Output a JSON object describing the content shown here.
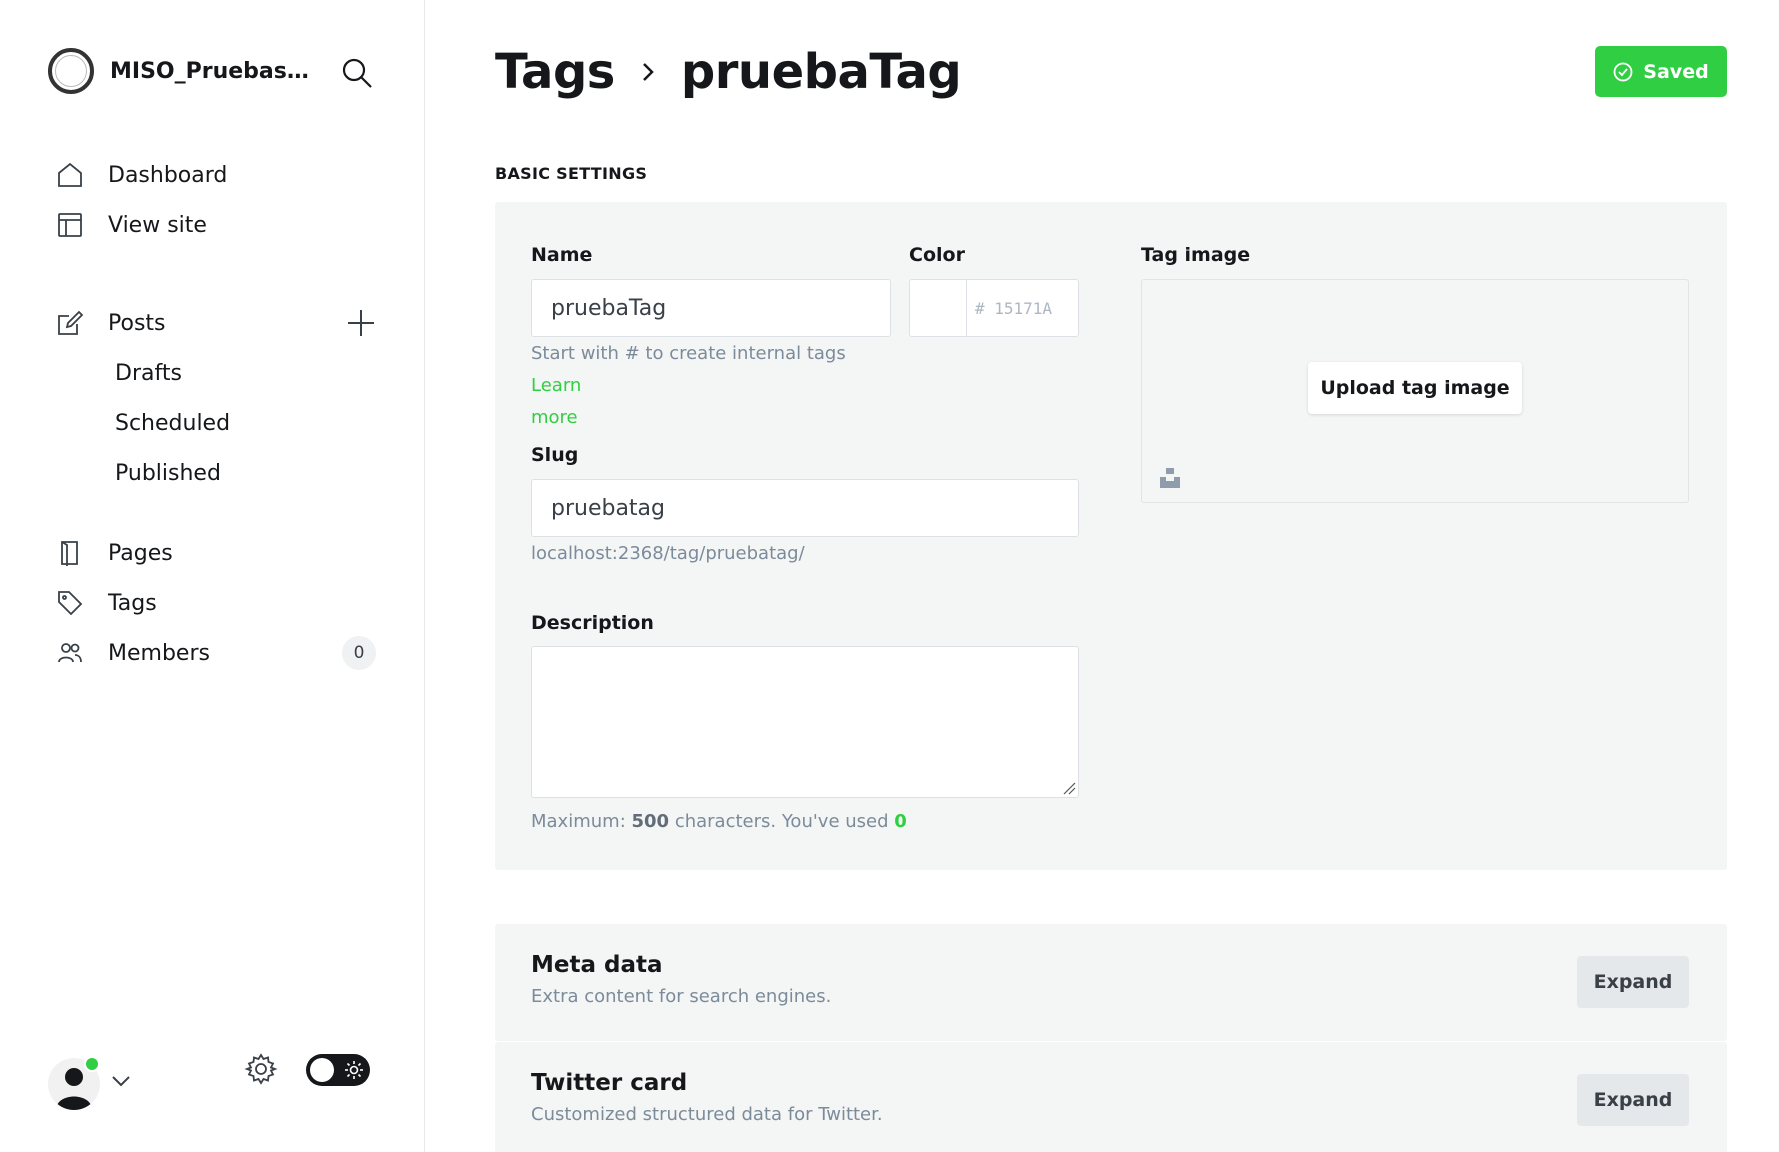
{
  "sidebar": {
    "site_name": "MISO_PruebasA...",
    "nav_top": [
      {
        "label": "Dashboard",
        "icon": "home-icon"
      },
      {
        "label": "View site",
        "icon": "layout-icon"
      }
    ],
    "posts": {
      "label": "Posts",
      "icon": "edit-icon"
    },
    "posts_sub": [
      "Drafts",
      "Scheduled",
      "Published"
    ],
    "nav_bottom": [
      {
        "label": "Pages",
        "icon": "page-icon"
      },
      {
        "label": "Tags",
        "icon": "tag-icon"
      },
      {
        "label": "Members",
        "icon": "members-icon",
        "count": "0"
      }
    ]
  },
  "header": {
    "breadcrumb_parent": "Tags",
    "breadcrumb_current": "pruebaTag",
    "saved_label": "Saved"
  },
  "basic_settings": {
    "section_title": "BASIC SETTINGS",
    "name_label": "Name",
    "name_value": "pruebaTag",
    "name_hint": "Start with # to create internal tags",
    "name_hint_link_1": "Learn",
    "name_hint_link_2": "more",
    "color_label": "Color",
    "color_hex": "# 15171A",
    "tag_image_label": "Tag image",
    "upload_label": "Upload tag image",
    "slug_label": "Slug",
    "slug_value": "pruebatag",
    "slug_url": "localhost:2368/tag/pruebatag/",
    "description_label": "Description",
    "description_value": "",
    "desc_hint_prefix": "Maximum:",
    "desc_hint_max": "500",
    "desc_hint_mid": "characters. You've used",
    "desc_hint_used": "0"
  },
  "sections": [
    {
      "title": "Meta data",
      "subtitle": "Extra content for search engines.",
      "button": "Expand"
    },
    {
      "title": "Twitter card",
      "subtitle": "Customized structured data for Twitter.",
      "button": "Expand"
    }
  ],
  "colors": {
    "accent": "#30cf43",
    "text": "#15171a",
    "panel_bg": "#f4f5f5"
  }
}
